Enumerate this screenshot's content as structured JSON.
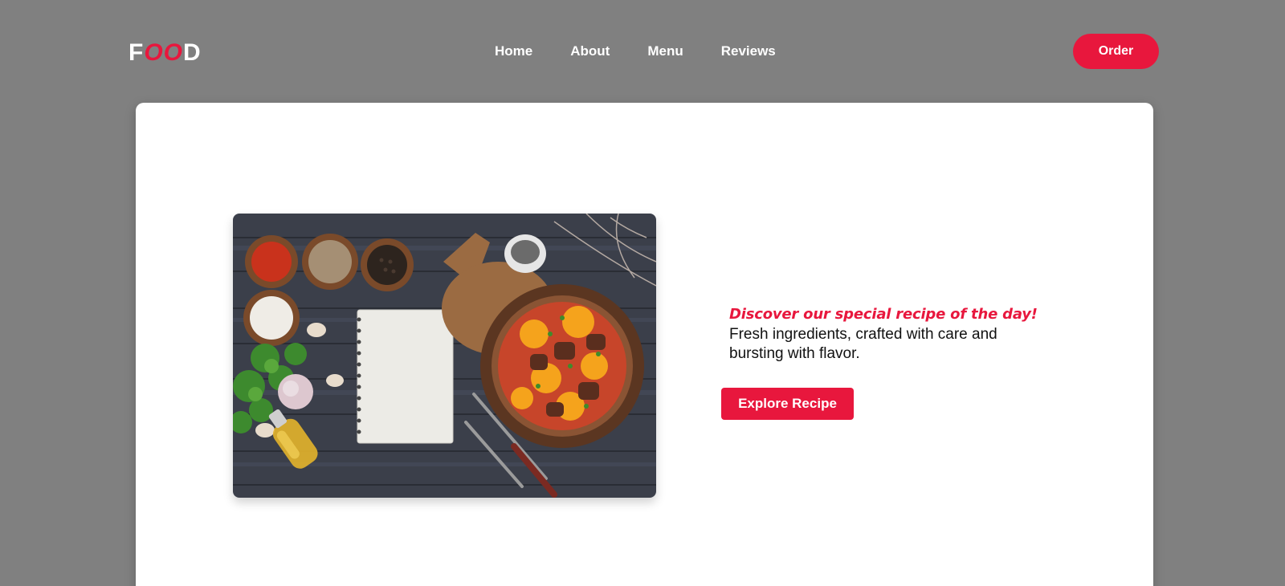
{
  "header": {
    "logo": {
      "part1": "F",
      "accent": "OO",
      "part2": "D"
    },
    "nav": [
      "Home",
      "About",
      "Menu",
      "Reviews"
    ],
    "order_label": "Order"
  },
  "hero": {
    "image_icon": "food-photo",
    "headline": "Discover our special recipe of the day!",
    "subtext": "Fresh ingredients, crafted with care and bursting with flavor.",
    "button_label": "Explore Recipe"
  },
  "colors": {
    "background": "#808080",
    "accent": "#e8173d",
    "card": "#ffffff"
  }
}
